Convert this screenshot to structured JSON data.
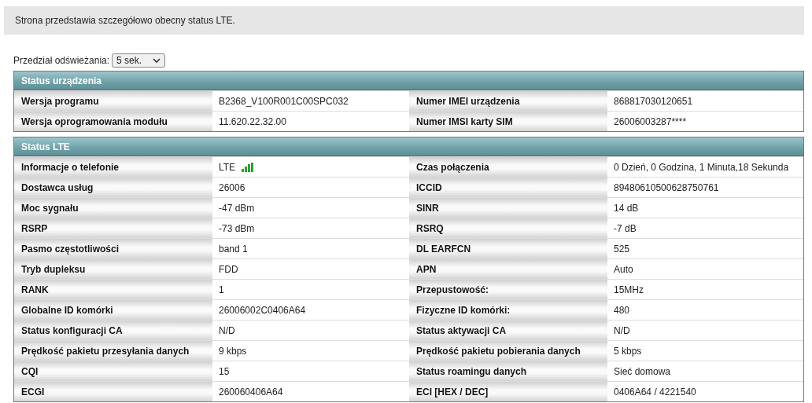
{
  "banner": "Strona przedstawia szczegółowo obecny status LTE.",
  "refresh": {
    "label": "Przedział odświeżania:",
    "value": "5 sek."
  },
  "sections": [
    {
      "title": "Status urządzenia",
      "rows": [
        [
          {
            "label": "Wersja programu",
            "value": "B2368_V100R001C00SPC032",
            "kind": "text"
          },
          {
            "label": "Numer IMEI urządzenia",
            "value": "868817030120651",
            "kind": "text"
          }
        ],
        [
          {
            "label": "Wersja oprogramowania modułu",
            "value": "11.620.22.32.00",
            "kind": "text"
          },
          {
            "label": "Numer IMSI karty SIM",
            "value": "26006003287****",
            "kind": "text"
          }
        ]
      ]
    },
    {
      "title": "Status LTE",
      "rows": [
        [
          {
            "label": "Informacje o telefonie",
            "value": "LTE",
            "kind": "signal"
          },
          {
            "label": "Czas połączenia",
            "value": "0 Dzień, 0 Godzina, 1 Minuta,18 Sekunda",
            "kind": "text"
          }
        ],
        [
          {
            "label": "Dostawca usług",
            "value": "26006",
            "kind": "text"
          },
          {
            "label": "ICCID",
            "value": "89480610500628750761",
            "kind": "text"
          }
        ],
        [
          {
            "label": "Moc sygnału",
            "value": "-47 dBm",
            "kind": "text"
          },
          {
            "label": "SINR",
            "value": "14 dB",
            "kind": "text"
          }
        ],
        [
          {
            "label": "RSRP",
            "value": "-73 dBm",
            "kind": "text"
          },
          {
            "label": "RSRQ",
            "value": "-7 dB",
            "kind": "text"
          }
        ],
        [
          {
            "label": "Pasmo częstotliwości",
            "value": "band 1",
            "kind": "text"
          },
          {
            "label": "DL EARFCN",
            "value": "525",
            "kind": "text"
          }
        ],
        [
          {
            "label": "Tryb dupleksu",
            "value": "FDD",
            "kind": "text"
          },
          {
            "label": "APN",
            "value": "Auto",
            "kind": "text"
          }
        ],
        [
          {
            "label": "RANK",
            "value": "1",
            "kind": "text"
          },
          {
            "label": "Przepustowość:",
            "value": "15MHz",
            "kind": "text"
          }
        ],
        [
          {
            "label": "Globalne ID komórki",
            "value": "26006002C0406A64",
            "kind": "text"
          },
          {
            "label": "Fizyczne ID komórki:",
            "value": "480",
            "kind": "text"
          }
        ],
        [
          {
            "label": "Status konfiguracji CA",
            "value": "N/D",
            "kind": "text"
          },
          {
            "label": "Status aktywacji CA",
            "value": "N/D",
            "kind": "text"
          }
        ],
        [
          {
            "label": "Prędkość pakietu przesyłania danych",
            "value": "9 kbps",
            "kind": "text"
          },
          {
            "label": "Prędkość pakietu pobierania danych",
            "value": "5 kbps",
            "kind": "text"
          }
        ],
        [
          {
            "label": "CQI",
            "value": "15",
            "kind": "text"
          },
          {
            "label": "Status roamingu danych",
            "value": "Sieć domowa",
            "kind": "text"
          }
        ],
        [
          {
            "label": "ECGI",
            "value": "260060406A64",
            "kind": "text"
          },
          {
            "label": "ECI [HEX / DEC]",
            "value": "0406A64 / 4221540",
            "kind": "text"
          }
        ]
      ]
    }
  ]
}
